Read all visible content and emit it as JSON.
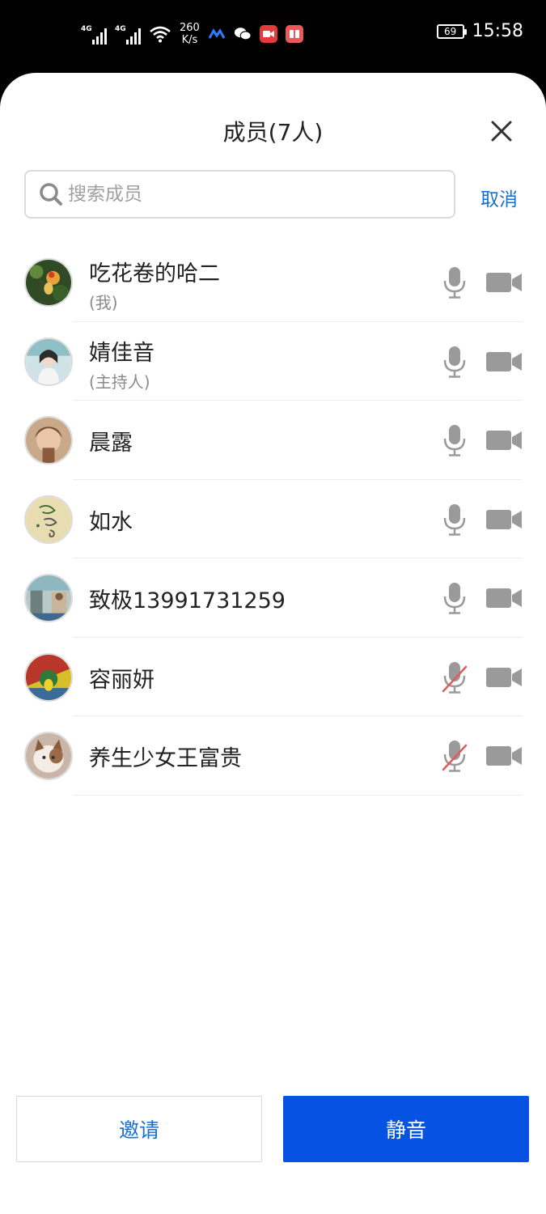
{
  "status_bar": {
    "network_1": "4G",
    "network_2": "4G",
    "speed_value": "260",
    "speed_unit": "K/s",
    "battery": "69",
    "time": "15:58",
    "icons": [
      "signal-icon",
      "signal-icon",
      "wifi-icon",
      "app-icon",
      "wechat-icon",
      "video-app-icon",
      "reader-app-icon"
    ]
  },
  "header": {
    "title": "成员(7人)",
    "close_icon": "close-icon"
  },
  "search": {
    "placeholder": "搜索成员",
    "value": "",
    "cancel_label": "取消"
  },
  "members": [
    {
      "name": "吃花卷的哈二",
      "role": "(我)",
      "mic": "on",
      "camera": "off"
    },
    {
      "name": "婧佳音",
      "role": "(主持人)",
      "mic": "on",
      "camera": "off"
    },
    {
      "name": "晨露",
      "role": "",
      "mic": "on",
      "camera": "off"
    },
    {
      "name": "如水",
      "role": "",
      "mic": "on",
      "camera": "off"
    },
    {
      "name": "致极13991731259",
      "role": "",
      "mic": "on",
      "camera": "off"
    },
    {
      "name": "容丽妍",
      "role": "",
      "mic": "muted",
      "camera": "off"
    },
    {
      "name": "养生少女王富贵",
      "role": "",
      "mic": "muted",
      "camera": "off"
    }
  ],
  "footer": {
    "invite_label": "邀请",
    "mute_label": "静音"
  },
  "colors": {
    "accent": "#1a6fd1",
    "primary_button": "#0652e3",
    "icon_gray": "#9a9a9a",
    "muted_slash": "#e05a5a"
  }
}
